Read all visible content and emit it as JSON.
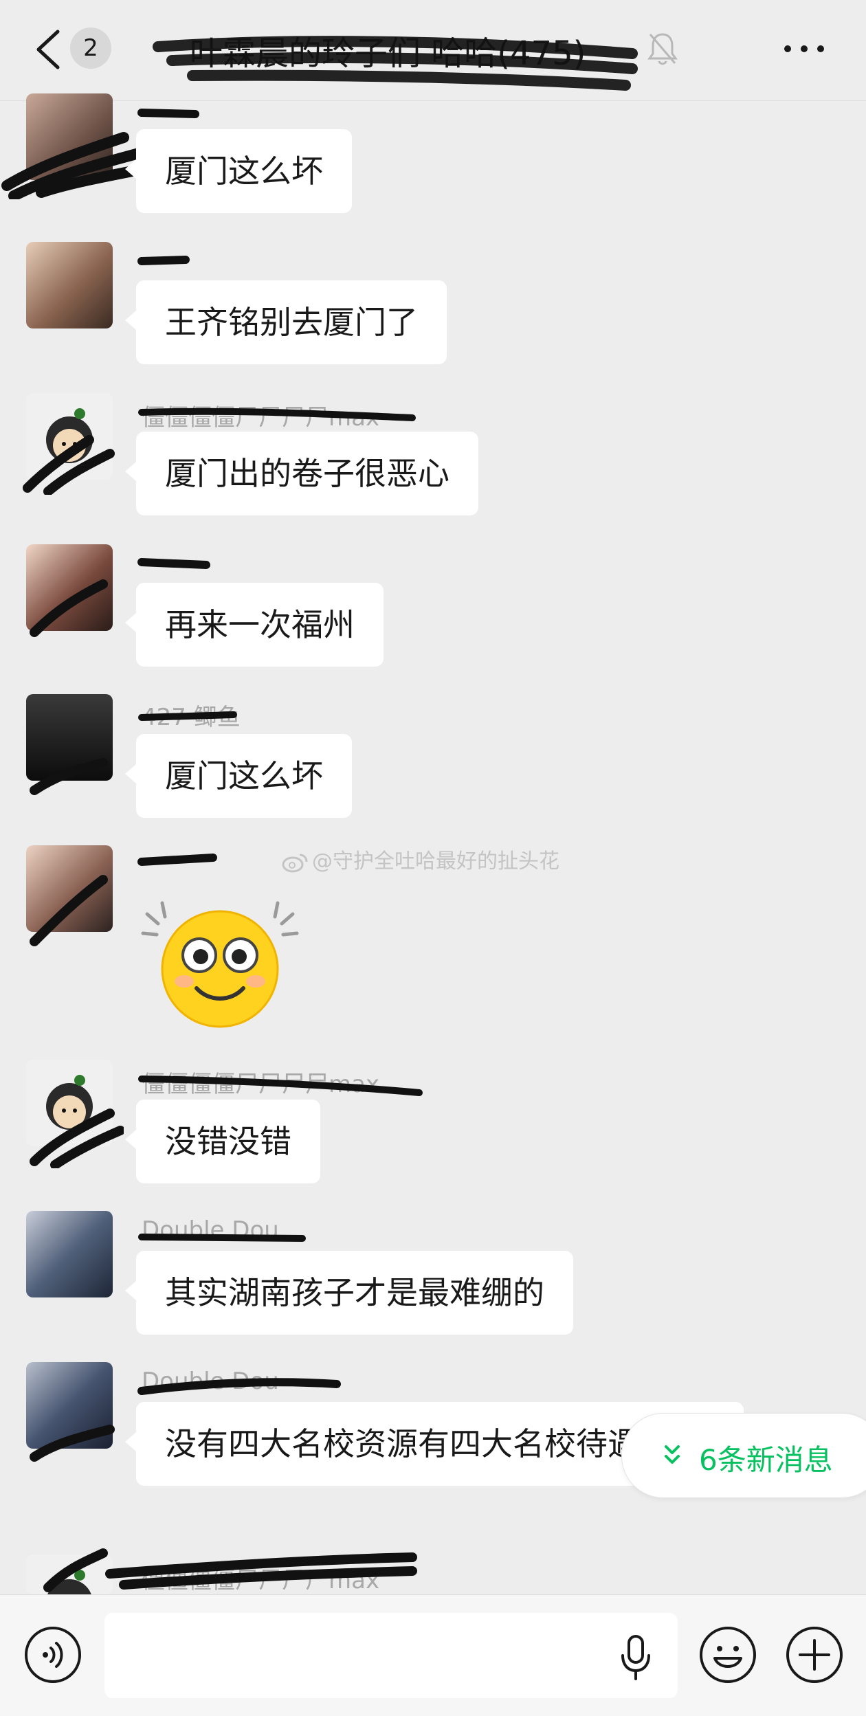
{
  "header": {
    "unread_count": "2",
    "title": "叶霖晨的玲子们 哈哈(475)"
  },
  "messages": [
    {
      "sender": "",
      "text": "厦门这么坏"
    },
    {
      "sender": "",
      "text": "王齐铭别去厦门了"
    },
    {
      "sender": "僵僵僵僵尸尸尸尸max",
      "text": "厦门出的卷子很恶心"
    },
    {
      "sender": "",
      "text": "再来一次福州"
    },
    {
      "sender": "427 鲫鱼",
      "text": "厦门这么坏"
    },
    {
      "sender": "",
      "sticker": "smiling-face-sticker"
    },
    {
      "sender": "僵僵僵僵尸尸尸尸max",
      "text": "没错没错"
    },
    {
      "sender": "Double Dou",
      "text": "其实湖南孩子才是最难绷的"
    },
    {
      "sender": "Double Dou",
      "text": "没有四大名校资源有四大名校待遇"
    },
    {
      "sender": "僵僵僵僵尸尸尸尸max",
      "text": ""
    }
  ],
  "watermark": "@守护全吐哈最好的扯头花",
  "new_messages_pill": "6条新消息",
  "input": {
    "placeholder": "",
    "value": ""
  },
  "colors": {
    "accent": "#07c160",
    "background": "#ededed",
    "bubble": "#ffffff"
  }
}
